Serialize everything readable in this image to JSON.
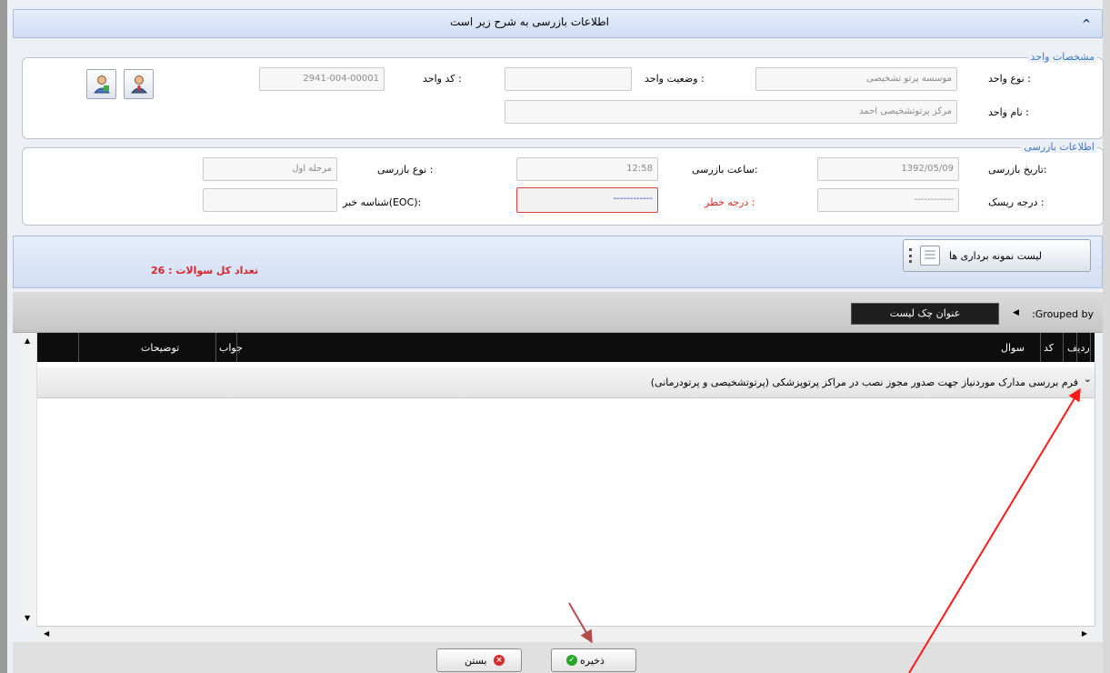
{
  "header": {
    "title": "اطلاعات بازرسی به شرح زیر است",
    "collapse_icon": "chevron-up-icon"
  },
  "unit": {
    "legend": "مشخصات واحد",
    "type_label": "نوع واحد :",
    "type_value": "موسسه پرتو تشخیصی",
    "status_label": "وضعیت واحد :",
    "status_value": "",
    "code_label": "کد واحد :",
    "code_value": "2941-004-00001",
    "name_label": "نام واحد :",
    "name_value": "مرکز پرتوتشخیصی احمد"
  },
  "inspection": {
    "legend": "اطلاعات بازرسی",
    "date_label": "تاریخ بازرسی:",
    "date_value": "1392/05/09",
    "time_label": "ساعت بازرسی:",
    "time_value": "12:58",
    "type_label": "نوع بازرسی :",
    "type_value": "مرحله اول",
    "risk_level_label": "درجه ریسک :",
    "risk_level_value": "------------",
    "danger_label": "درجه خطر :",
    "danger_value": "------------",
    "eoc_label": "شناسه خبر(EOC):",
    "eoc_value": ""
  },
  "toolbar": {
    "question_count": "تعداد کل سوالات : 26",
    "sample_list_label": "لیست نمونه برداری ها"
  },
  "grouping": {
    "grouped_by": ":Grouped by",
    "chip": "عنوان چک لیست"
  },
  "grid": {
    "columns": [
      "ردیف",
      "کد",
      "سوال",
      "جواب",
      "توضیحات"
    ],
    "group_row": "فرم بررسی مدارک موردنیاز جهت صدور مجوز نصب در مراکز پرتوپزشکی (پرتوتشخیصی و پرتودرمانی)"
  },
  "footer": {
    "save_label": "ذخیره",
    "close_label": "بستن"
  },
  "colors": {
    "accent_blue": "#3a78c9",
    "danger_red": "#e2251c",
    "annotation_red": "#ff1a1a",
    "annotation_brown": "#b44c4c"
  }
}
